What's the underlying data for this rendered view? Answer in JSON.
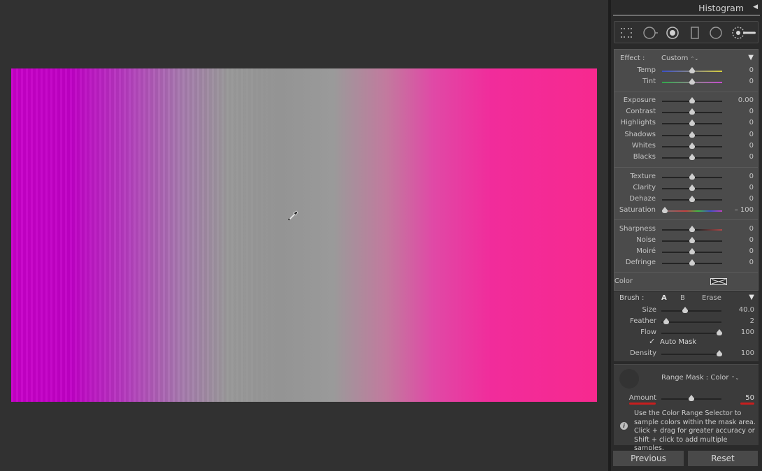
{
  "panel": {
    "histogram_title": "Histogram",
    "histogram_toggle": "◀",
    "tools": [
      {
        "name": "crop-overlay-icon"
      },
      {
        "name": "spot-removal-icon"
      },
      {
        "name": "red-eye-icon"
      },
      {
        "name": "graduated-filter-icon"
      },
      {
        "name": "radial-filter-icon"
      },
      {
        "name": "adjustment-brush-icon"
      }
    ]
  },
  "effect": {
    "label": "Effect :",
    "preset": "Custom",
    "preset_arrow": "⌃⌄",
    "collapse": "▼",
    "color_label": "Color",
    "sliders": [
      {
        "label": "Temp",
        "value": "0",
        "level": 0.5
      },
      {
        "label": "Tint",
        "value": "0",
        "level": 0.5
      },
      {
        "label": "Exposure",
        "value": "0.00",
        "level": 0.5
      },
      {
        "label": "Contrast",
        "value": "0",
        "level": 0.5
      },
      {
        "label": "Highlights",
        "value": "0",
        "level": 0.5
      },
      {
        "label": "Shadows",
        "value": "0",
        "level": 0.5
      },
      {
        "label": "Whites",
        "value": "0",
        "level": 0.5
      },
      {
        "label": "Blacks",
        "value": "0",
        "level": 0.5
      },
      {
        "label": "Texture",
        "value": "0",
        "level": 0.5
      },
      {
        "label": "Clarity",
        "value": "0",
        "level": 0.5
      },
      {
        "label": "Dehaze",
        "value": "0",
        "level": 0.5
      },
      {
        "label": "Saturation",
        "value": "– 100",
        "level": 0.05
      },
      {
        "label": "Sharpness",
        "value": "0",
        "level": 0.5
      },
      {
        "label": "Noise",
        "value": "0",
        "level": 0.5
      },
      {
        "label": "Moiré",
        "value": "0",
        "level": 0.5
      },
      {
        "label": "Defringe",
        "value": "0",
        "level": 0.5
      }
    ]
  },
  "brush": {
    "label": "Brush :",
    "tab_a": "A",
    "tab_b": "B",
    "tab_erase": "Erase",
    "collapse": "▼",
    "automask_label": "Auto Mask",
    "automask_checked": "✓",
    "sliders": [
      {
        "label": "Size",
        "value": "40.0",
        "level": 0.4
      },
      {
        "label": "Feather",
        "value": "2",
        "level": 0.08
      },
      {
        "label": "Flow",
        "value": "100",
        "level": 0.96
      },
      {
        "label": "Density",
        "value": "100",
        "level": 0.96
      }
    ]
  },
  "range_mask": {
    "label": "Range Mask : Color",
    "arrow": "⌃⌄",
    "amount_label": "Amount",
    "amount_value": "50",
    "amount_level": 0.5,
    "info_icon": "i",
    "info_text": "Use the Color Range Selector to sample colors within the mask area. Click + drag for greater accuracy or Shift + click to add multiple samples."
  },
  "buttons": {
    "previous": "Previous",
    "reset": "Reset"
  },
  "colors": {
    "accent_red": "#c81e1e",
    "photo_magenta": "#c800c8",
    "photo_pink": "#f7298f",
    "photo_gray": "#949494"
  }
}
